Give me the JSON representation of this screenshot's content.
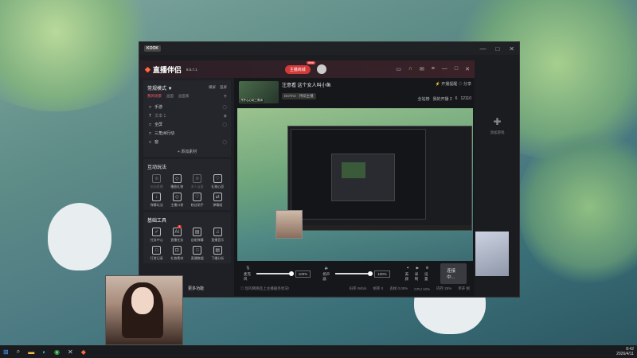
{
  "outer_window": {
    "logo": "KOOK",
    "controls": [
      "—",
      "□",
      "✕"
    ]
  },
  "app": {
    "name": "直播伴侣",
    "version": "8.5.7.1",
    "live_button": "主播商城",
    "live_badge": "new",
    "top_icons": [
      "message-icon",
      "headset-icon",
      "mail-icon",
      "settings-icon",
      "minimize-icon",
      "maximize-icon",
      "close-icon"
    ]
  },
  "sidebar": {
    "mode_label": "常规模式 ▼",
    "mode_actions": [
      "横屏",
      "竖屏"
    ],
    "scene_tabs": [
      "我的场景",
      "画面",
      "画面素"
    ],
    "scenes": [
      {
        "name": "手游",
        "icon": "□"
      },
      {
        "name": "文本 1",
        "icon": "T"
      },
      {
        "name": "全屏",
        "icon": "□"
      },
      {
        "name": "三角洲行动",
        "icon": "□"
      },
      {
        "name": "窗",
        "icon": "□"
      }
    ],
    "add_material": "+ 添加素材",
    "interactive_title": "互动玩法",
    "interactive_tools": [
      {
        "label": "启动直播",
        "icon": "⊕",
        "dim": true
      },
      {
        "label": "播放礼物",
        "icon": "◇",
        "dim": false
      },
      {
        "label": "多人连麦",
        "icon": "⊕",
        "dim": true
      },
      {
        "label": "礼物心愿",
        "icon": "♡",
        "dim": false
      },
      {
        "label": "弹幕玩法",
        "icon": "↓",
        "dim": false
      },
      {
        "label": "主播口袋",
        "icon": "◇",
        "dim": false
      },
      {
        "label": "粉丝助手",
        "icon": "♡",
        "dim": false
      },
      {
        "label": "弹幕姬",
        "icon": "⇄",
        "dim": false
      }
    ],
    "basic_title": "基础工具",
    "basic_tools": [
      {
        "label": "任务中心",
        "icon": "✓",
        "badge": ""
      },
      {
        "label": "直播任务",
        "icon": "AI",
        "badge": "1"
      },
      {
        "label": "自制弹幕",
        "icon": "▤",
        "badge": ""
      },
      {
        "label": "直播音乐",
        "icon": "♫",
        "badge": ""
      },
      {
        "label": "打赏记录",
        "icon": "□",
        "badge": ""
      },
      {
        "label": "礼物素材",
        "icon": "⊡",
        "badge": ""
      },
      {
        "label": "直播数据",
        "icon": "□",
        "badge": ""
      },
      {
        "label": "下播分析",
        "icon": "▤",
        "badge": ""
      }
    ],
    "more": "更多功能"
  },
  "room": {
    "thumb_label": "开开心心玩三角洲",
    "title": "注意看 这个女人叫小鱼",
    "category": "DOTA2 · 持续主播",
    "stats": "⚡ 开播提醒   ◇ 分享",
    "stats2": [
      "全站榜",
      "我的开播 2",
      "6",
      "12110"
    ]
  },
  "controls": {
    "mic_label": "麦克风",
    "mic_pct": "100%",
    "mic_level": 1.0,
    "speaker_label": "扬声器",
    "speaker_pct": "100%",
    "speaker_level": 1.0,
    "extras": [
      {
        "label": "美颜",
        "icon": "✦"
      },
      {
        "label": "录制",
        "icon": "▶"
      },
      {
        "label": "设置",
        "icon": "⚙"
      }
    ],
    "connect_button": "连接中..."
  },
  "status_bar": {
    "left": "◎ 您的网络连上主播服务状况!",
    "items": [
      "码率 0Kb/s",
      "帧率 0",
      "丢帧 0.00%",
      "CPU 10%",
      "内存 25%",
      "单开 帧"
    ]
  },
  "right_panel": {
    "label": "添加游戏"
  },
  "taskbar": {
    "icons": [
      "windows-start-icon",
      "search-icon",
      "file-explorer-icon",
      "edge-icon",
      "wechat-icon",
      "kook-icon",
      "app-icon"
    ],
    "time": "8:42",
    "date": "2026/4/11"
  }
}
